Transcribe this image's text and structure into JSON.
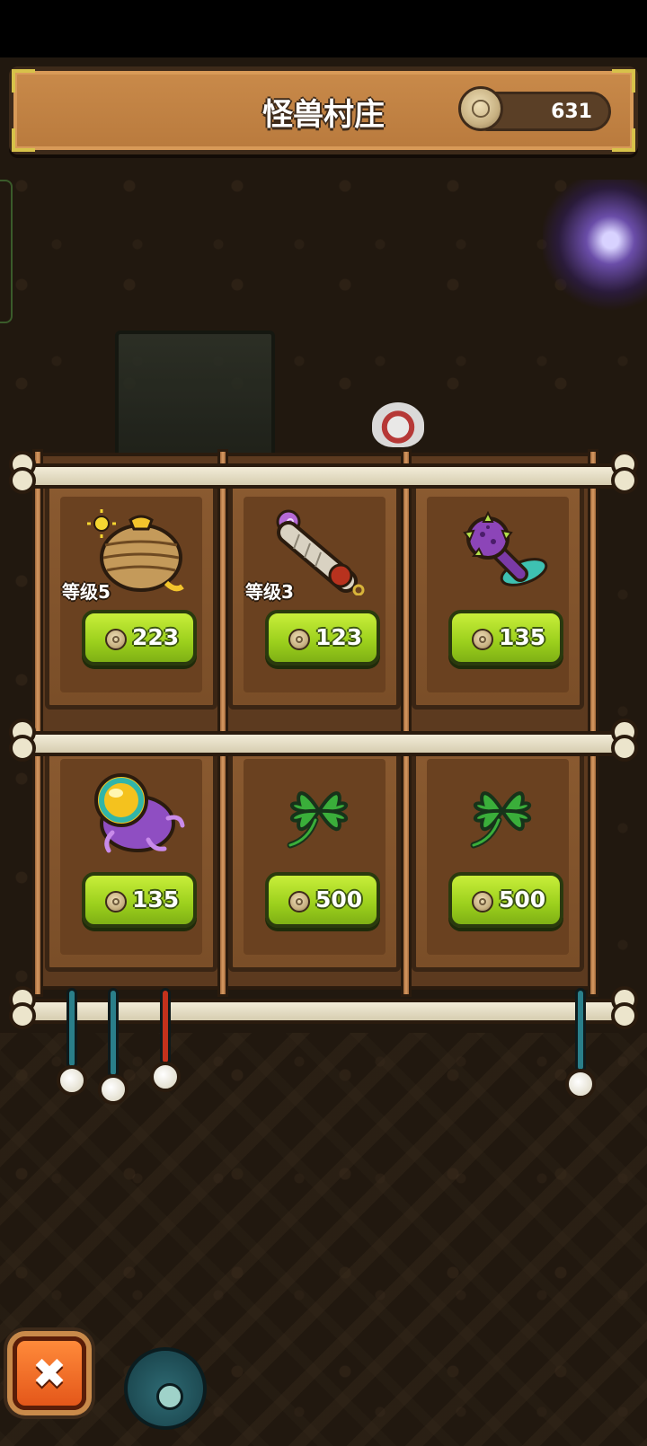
{
  "header": {
    "title": "怪兽村庄",
    "coins": "631"
  },
  "shop": {
    "items": [
      {
        "name_icon": "beehive-icon",
        "level": "等级5",
        "price": "223"
      },
      {
        "name_icon": "bone-club-icon",
        "level": "等级3",
        "price": "123"
      },
      {
        "name_icon": "spiked-purple-club-icon",
        "level": "",
        "price": "135"
      },
      {
        "name_icon": "purple-slime-egg-icon",
        "level": "",
        "price": "135"
      },
      {
        "name_icon": "four-leaf-clover-icon",
        "level": "",
        "price": "500"
      },
      {
        "name_icon": "four-leaf-clover-icon",
        "level": "",
        "price": "500"
      }
    ]
  },
  "footer": {
    "close_label": "✖"
  }
}
